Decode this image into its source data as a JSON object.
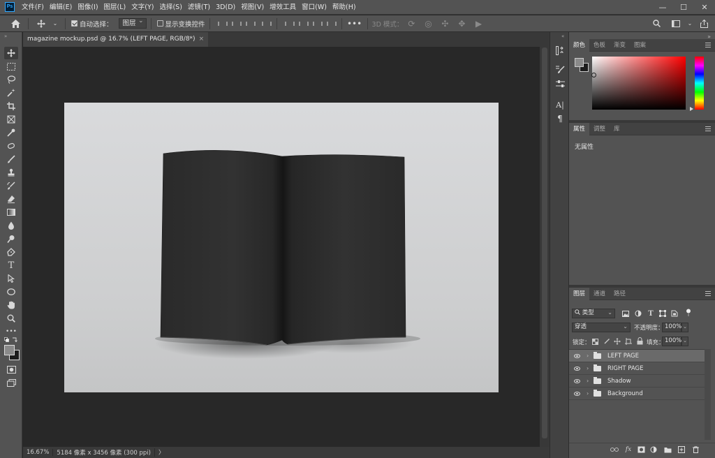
{
  "menubar": {
    "logo": "Ps",
    "items": [
      "文件(F)",
      "编辑(E)",
      "图像(I)",
      "图层(L)",
      "文字(Y)",
      "选择(S)",
      "滤镜(T)",
      "3D(D)",
      "视图(V)",
      "增效工具",
      "窗口(W)",
      "帮助(H)"
    ],
    "window_controls": [
      "—",
      "☐",
      "✕"
    ]
  },
  "options": {
    "auto_select_label": "自动选择：",
    "auto_select_value": "图层",
    "show_transform_label": "显示变换控件",
    "mode_3d_label": "3D 模式："
  },
  "document": {
    "tab_label": "magazine mockup.psd @ 16.7% (LEFT PAGE, RGB/8*)",
    "close_symbol": "×",
    "colors": {
      "page_dark": "#2b2b2b",
      "page_edge": "#1f1f1f",
      "background": "#d5d6d8"
    }
  },
  "statusbar": {
    "zoom": "16.67%",
    "info": "5184 像素 x 3456 像素 (300 ppi)",
    "arrow": "〉"
  },
  "panels": {
    "color": {
      "tabs": [
        "颜色",
        "色板",
        "渐变",
        "图案"
      ]
    },
    "properties": {
      "tabs": [
        "属性",
        "调整",
        "库"
      ],
      "empty_text": "无属性"
    },
    "layers": {
      "tabs": [
        "图层",
        "通道",
        "路径"
      ],
      "filter_label": "类型",
      "blend_mode": "穿透",
      "opacity_label": "不透明度：",
      "opacity_value": "100%",
      "lock_label": "锁定：",
      "fill_label": "填充：",
      "fill_value": "100%",
      "items": [
        {
          "name": "LEFT PAGE"
        },
        {
          "name": "RIGHT PAGE"
        },
        {
          "name": "Shadow"
        },
        {
          "name": "Background"
        }
      ],
      "footer_icons": [
        "link-icon",
        "fx-icon",
        "mask-icon",
        "adjustment-icon",
        "group-icon",
        "new-layer-icon",
        "trash-icon"
      ]
    }
  }
}
